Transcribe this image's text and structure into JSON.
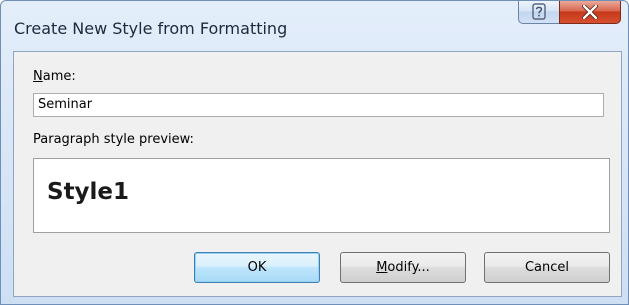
{
  "window": {
    "title": "Create New Style from Formatting",
    "help_icon": "help-icon",
    "close_icon": "close-icon"
  },
  "form": {
    "name_label_accel": "N",
    "name_label_rest": "ame:",
    "name_value": "Seminar",
    "preview_label": "Paragraph style preview:",
    "preview_text": "Style1"
  },
  "buttons": {
    "ok_label": "OK",
    "modify_accel": "M",
    "modify_rest": "odify...",
    "cancel_label": "Cancel"
  },
  "colors": {
    "title_bar": "#dae7f7",
    "close_button": "#c5381a",
    "default_button_border": "#3c7fb1"
  }
}
